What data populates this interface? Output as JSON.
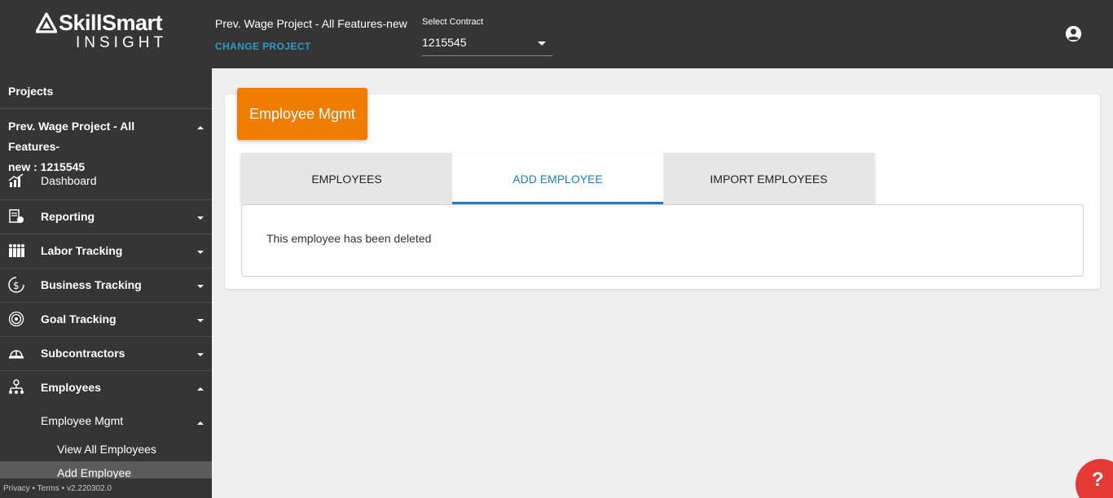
{
  "header": {
    "logo_word": "SkillSmart",
    "logo_sub": "INSIGHT",
    "project_name": "Prev. Wage Project - All Features-new",
    "change_project": "CHANGE PROJECT",
    "contract_label": "Select Contract",
    "contract_value": "1215545"
  },
  "sidebar": {
    "projects_label": "Projects",
    "project_line1": "Prev. Wage Project - All Features-",
    "project_line2": "new : 1215545",
    "items": [
      {
        "label": "Dashboard",
        "icon": "dashboard-icon"
      },
      {
        "label": "Reporting",
        "icon": "reporting-icon"
      },
      {
        "label": "Labor Tracking",
        "icon": "labor-tracking-icon"
      },
      {
        "label": "Business Tracking",
        "icon": "business-tracking-icon"
      },
      {
        "label": "Goal Tracking",
        "icon": "goal-tracking-icon"
      },
      {
        "label": "Subcontractors",
        "icon": "hardhat-icon"
      },
      {
        "label": "Employees",
        "icon": "org-chart-icon"
      }
    ],
    "sub_employee_mgmt": "Employee Mgmt",
    "sub_view_all": "View All Employees",
    "sub_add_employee": "Add Employee",
    "footer": "Privacy • Terms • v2.220302.0"
  },
  "main": {
    "card_title": "Employee Mgmt",
    "tabs": [
      {
        "label": "EMPLOYEES"
      },
      {
        "label": "ADD EMPLOYEE"
      },
      {
        "label": "IMPORT EMPLOYEES"
      }
    ],
    "message": "This employee has been deleted"
  },
  "help_label": "?",
  "colors": {
    "header_bg": "#353535",
    "accent_orange": "#ee7d00",
    "link_blue": "#2f9bc6",
    "tab_active": "#1c7cc0",
    "help_red": "#e53935"
  }
}
